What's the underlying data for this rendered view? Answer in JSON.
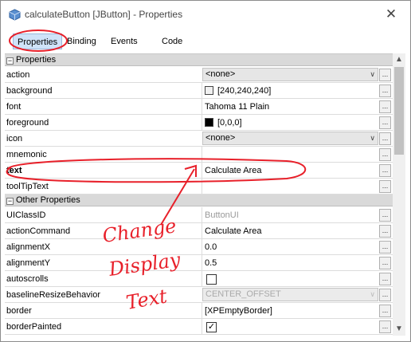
{
  "window": {
    "title": "calculateButton [JButton] - Properties",
    "close_glyph": "✕",
    "icon": "java-bean-icon"
  },
  "tabs": [
    {
      "label": "Properties",
      "active": true
    },
    {
      "label": "Binding"
    },
    {
      "label": "Events"
    },
    {
      "label": "Code"
    }
  ],
  "sections": {
    "properties": {
      "label": "Properties",
      "toggle": "−"
    },
    "other": {
      "label": "Other Properties",
      "toggle": "−"
    }
  },
  "rows": {
    "action": {
      "name": "action",
      "value": "<none>"
    },
    "background": {
      "name": "background",
      "value": "[240,240,240]",
      "swatch": "#f0f0f0"
    },
    "font": {
      "name": "font",
      "value": "Tahoma 11 Plain"
    },
    "foreground": {
      "name": "foreground",
      "value": "[0,0,0]",
      "swatch": "#000000"
    },
    "icon": {
      "name": "icon",
      "value": "<none>"
    },
    "mnemonic": {
      "name": "mnemonic",
      "value": ""
    },
    "text": {
      "name": "text",
      "value": "Calculate Area"
    },
    "tooltip": {
      "name": "toolTipText",
      "value": ""
    },
    "uiclassid": {
      "name": "UIClassID",
      "value": "ButtonUI"
    },
    "actioncommand": {
      "name": "actionCommand",
      "value": "Calculate Area"
    },
    "alignx": {
      "name": "alignmentX",
      "value": "0.0"
    },
    "aligny": {
      "name": "alignmentY",
      "value": "0.5"
    },
    "autoscrolls": {
      "name": "autoscrolls",
      "checked": false
    },
    "baseline": {
      "name": "baselineResizeBehavior",
      "value": "CENTER_OFFSET"
    },
    "border": {
      "name": "border",
      "value": "[XPEmptyBorder]"
    },
    "borderpainted": {
      "name": "borderPainted",
      "checked": true
    }
  },
  "ellipsis": "...",
  "checkmark": "✓",
  "scroll": {
    "up": "▲",
    "down": "▼"
  },
  "annotation": {
    "color": "#e8202a",
    "lines": [
      "Change",
      "Display",
      "Text"
    ]
  }
}
